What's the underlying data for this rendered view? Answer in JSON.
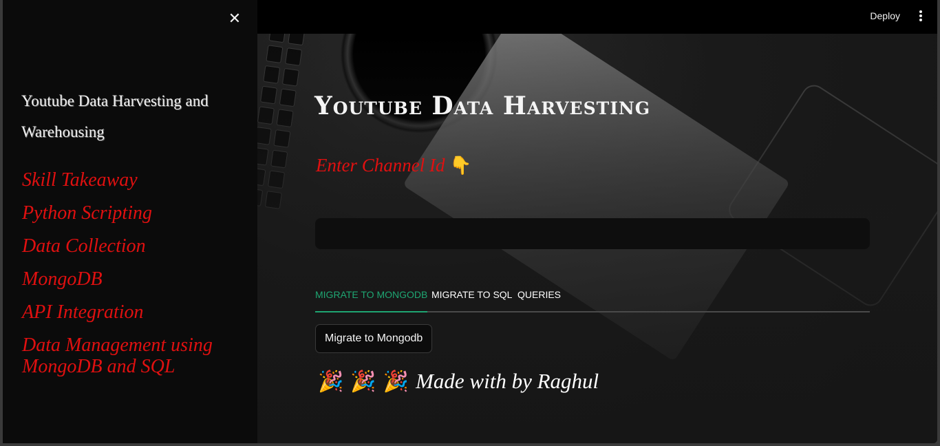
{
  "header": {
    "deploy_label": "Deploy"
  },
  "sidebar": {
    "title": "Youtube Data Harvesting and Warehousing",
    "skills": [
      "Skill Takeaway",
      "Python Scripting",
      "Data Collection",
      "MongoDB",
      "API Integration",
      "Data Management using MongoDB and SQL"
    ]
  },
  "main": {
    "title": "Youtube Data Harvesting",
    "input_label": "Enter Channel Id",
    "input_label_emoji": "👇",
    "channel_input": {
      "value": "",
      "placeholder": ""
    },
    "tabs": [
      {
        "label": "MIGRATE TO MONGODB",
        "active": true
      },
      {
        "label": "MIGRATE TO SQL",
        "active": false
      },
      {
        "label": "QUERIES",
        "active": false
      }
    ],
    "migrate_button_label": "Migrate to Mongodb",
    "footer_emojis": [
      "🎉",
      "🎉",
      "🎉"
    ],
    "footer_text": "Made with by Raghul"
  },
  "colors": {
    "accent_red": "#e01010",
    "tab_active": "#1ea672",
    "sidebar_bg": "#0b0b0b",
    "topbar_bg": "#000000"
  },
  "icons": {
    "close": "close-icon",
    "menu": "kebab-menu-icon"
  }
}
